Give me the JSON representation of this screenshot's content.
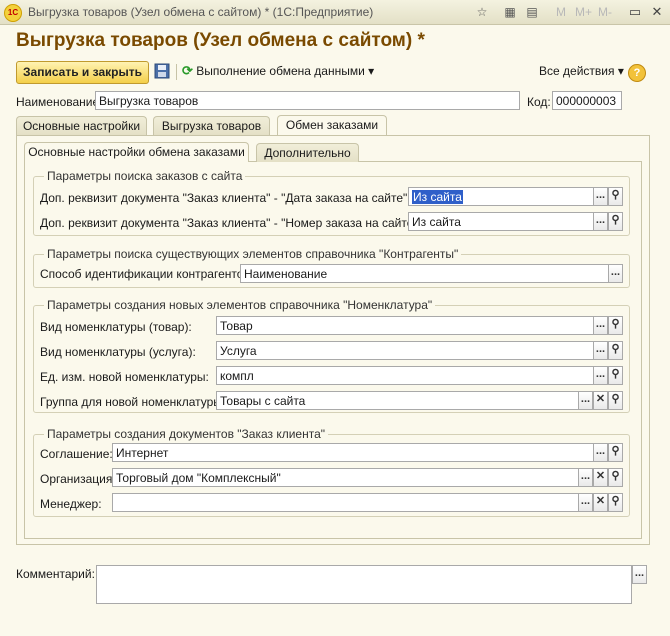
{
  "titlebar": {
    "logo_text": "1С",
    "title": "Выгрузка товаров (Узел обмена с сайтом) * (1С:Предприятие)",
    "mem": [
      "M",
      "M+",
      "M-"
    ],
    "icons": [
      "star-icon",
      "calculator-icon",
      "calendar-icon",
      "minimize-icon",
      "close-icon"
    ]
  },
  "form": {
    "title": "Выгрузка товаров (Узел обмена с сайтом) *"
  },
  "toolbar": {
    "save_close_label": "Записать и закрыть",
    "exchange_label": "Выполнение обмена данными",
    "all_actions_label": "Все действия",
    "help_label": "?"
  },
  "header_fields": {
    "name_label": "Наименование:",
    "name_value": "Выгрузка товаров",
    "code_label": "Код:",
    "code_value": "000000003"
  },
  "tabs": [
    {
      "label": "Основные настройки"
    },
    {
      "label": "Выгрузка товаров"
    },
    {
      "label": "Обмен заказами"
    }
  ],
  "subtabs": [
    {
      "label": "Основные настройки обмена заказами"
    },
    {
      "label": "Дополнительно"
    }
  ],
  "groups": {
    "search": {
      "title": "Параметры поиска заказов с сайта",
      "fields": [
        {
          "label": "Доп. реквизит документа \"Заказ клиента\" - \"Дата заказа на сайте\":",
          "value": "Из сайта"
        },
        {
          "label": "Доп. реквизит документа \"Заказ клиента\" - \"Номер заказа на сайте\":",
          "value": "Из сайта"
        }
      ]
    },
    "contractors": {
      "title": "Параметры поиска существующих элементов справочника \"Контрагенты\"",
      "fields": [
        {
          "label": "Способ идентификации контрагентов:",
          "value": "Наименование"
        }
      ]
    },
    "nomenclature": {
      "title": "Параметры создания новых элементов справочника \"Номенклатура\"",
      "fields": [
        {
          "label": "Вид номенклатуры (товар):",
          "value": "Товар"
        },
        {
          "label": "Вид номенклатуры (услуга):",
          "value": "Услуга"
        },
        {
          "label": "Ед. изм. новой номенклатуры:",
          "value": "компл"
        },
        {
          "label": "Группа для новой номенклатуры:",
          "value": "Товары с сайта"
        }
      ]
    },
    "orders": {
      "title": "Параметры создания документов \"Заказ клиента\"",
      "fields": [
        {
          "label": "Соглашение:",
          "value": "Интернет"
        },
        {
          "label": "Организация:",
          "value": "Торговый дом \"Комплексный\""
        },
        {
          "label": "Менеджер:",
          "value": ""
        }
      ]
    }
  },
  "comment": {
    "label": "Комментарий:",
    "value": ""
  },
  "glyphs": {
    "ellipsis": "...",
    "search": "⚲",
    "clear": "✕",
    "dropdown": "▾"
  },
  "colors": {
    "title_color": "#7a4a00",
    "primary_button": "#f4cf4a",
    "selection": "#2f5fc9"
  }
}
